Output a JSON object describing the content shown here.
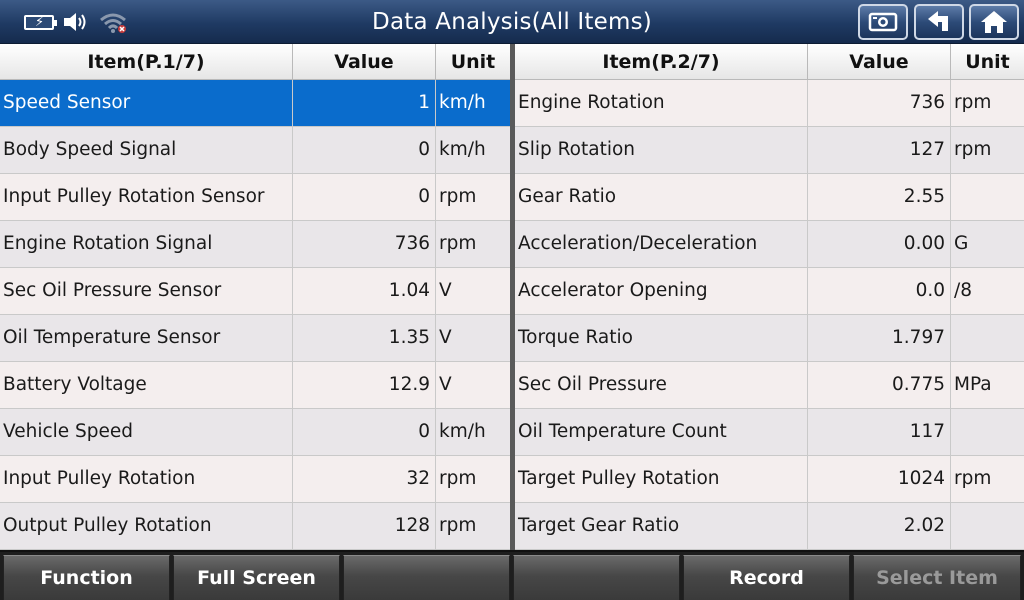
{
  "title": "Data Analysis(All Items)",
  "left_table": {
    "headers": {
      "item": "Item(P.1/7)",
      "value": "Value",
      "unit": "Unit"
    },
    "rows": [
      {
        "item": "Speed Sensor",
        "value": "1",
        "unit": "km/h"
      },
      {
        "item": "Body Speed Signal",
        "value": "0",
        "unit": "km/h"
      },
      {
        "item": "Input Pulley Rotation Sensor",
        "value": "0",
        "unit": "rpm"
      },
      {
        "item": "Engine Rotation Signal",
        "value": "736",
        "unit": "rpm"
      },
      {
        "item": "Sec Oil Pressure Sensor",
        "value": "1.04",
        "unit": "V"
      },
      {
        "item": "Oil Temperature Sensor",
        "value": "1.35",
        "unit": "V"
      },
      {
        "item": "Battery Voltage",
        "value": "12.9",
        "unit": "V"
      },
      {
        "item": "Vehicle Speed",
        "value": "0",
        "unit": "km/h"
      },
      {
        "item": "Input Pulley Rotation",
        "value": "32",
        "unit": "rpm"
      },
      {
        "item": "Output Pulley Rotation",
        "value": "128",
        "unit": "rpm"
      }
    ]
  },
  "right_table": {
    "headers": {
      "item": "Item(P.2/7)",
      "value": "Value",
      "unit": "Unit"
    },
    "rows": [
      {
        "item": "Engine Rotation",
        "value": "736",
        "unit": "rpm"
      },
      {
        "item": "Slip Rotation",
        "value": "127",
        "unit": "rpm"
      },
      {
        "item": "Gear Ratio",
        "value": "2.55",
        "unit": ""
      },
      {
        "item": "Acceleration/Deceleration",
        "value": "0.00",
        "unit": "G"
      },
      {
        "item": "Accelerator Opening",
        "value": "0.0",
        "unit": "/8"
      },
      {
        "item": "Torque Ratio",
        "value": "1.797",
        "unit": ""
      },
      {
        "item": "Sec Oil Pressure",
        "value": "0.775",
        "unit": "MPa"
      },
      {
        "item": "Oil Temperature Count",
        "value": "117",
        "unit": ""
      },
      {
        "item": "Target Pulley Rotation",
        "value": "1024",
        "unit": "rpm"
      },
      {
        "item": "Target Gear Ratio",
        "value": "2.02",
        "unit": ""
      }
    ]
  },
  "bottom_bar": [
    {
      "label": "Function",
      "enabled": true
    },
    {
      "label": "Full Screen",
      "enabled": true
    },
    {
      "label": "",
      "enabled": true
    },
    {
      "label": "",
      "enabled": true
    },
    {
      "label": "Record",
      "enabled": true
    },
    {
      "label": "Select Item",
      "enabled": false
    }
  ],
  "selected_row": "left_table.rows.0",
  "colors": {
    "title_bar": "#1f3a63",
    "selection": "#0a6ccc",
    "row_light": "#f4eeee",
    "row_alt": "#e9e6e9"
  },
  "icons": [
    "battery-charging-icon",
    "speaker-icon",
    "wifi-icon",
    "screenshot-icon",
    "back-icon",
    "home-icon"
  ]
}
